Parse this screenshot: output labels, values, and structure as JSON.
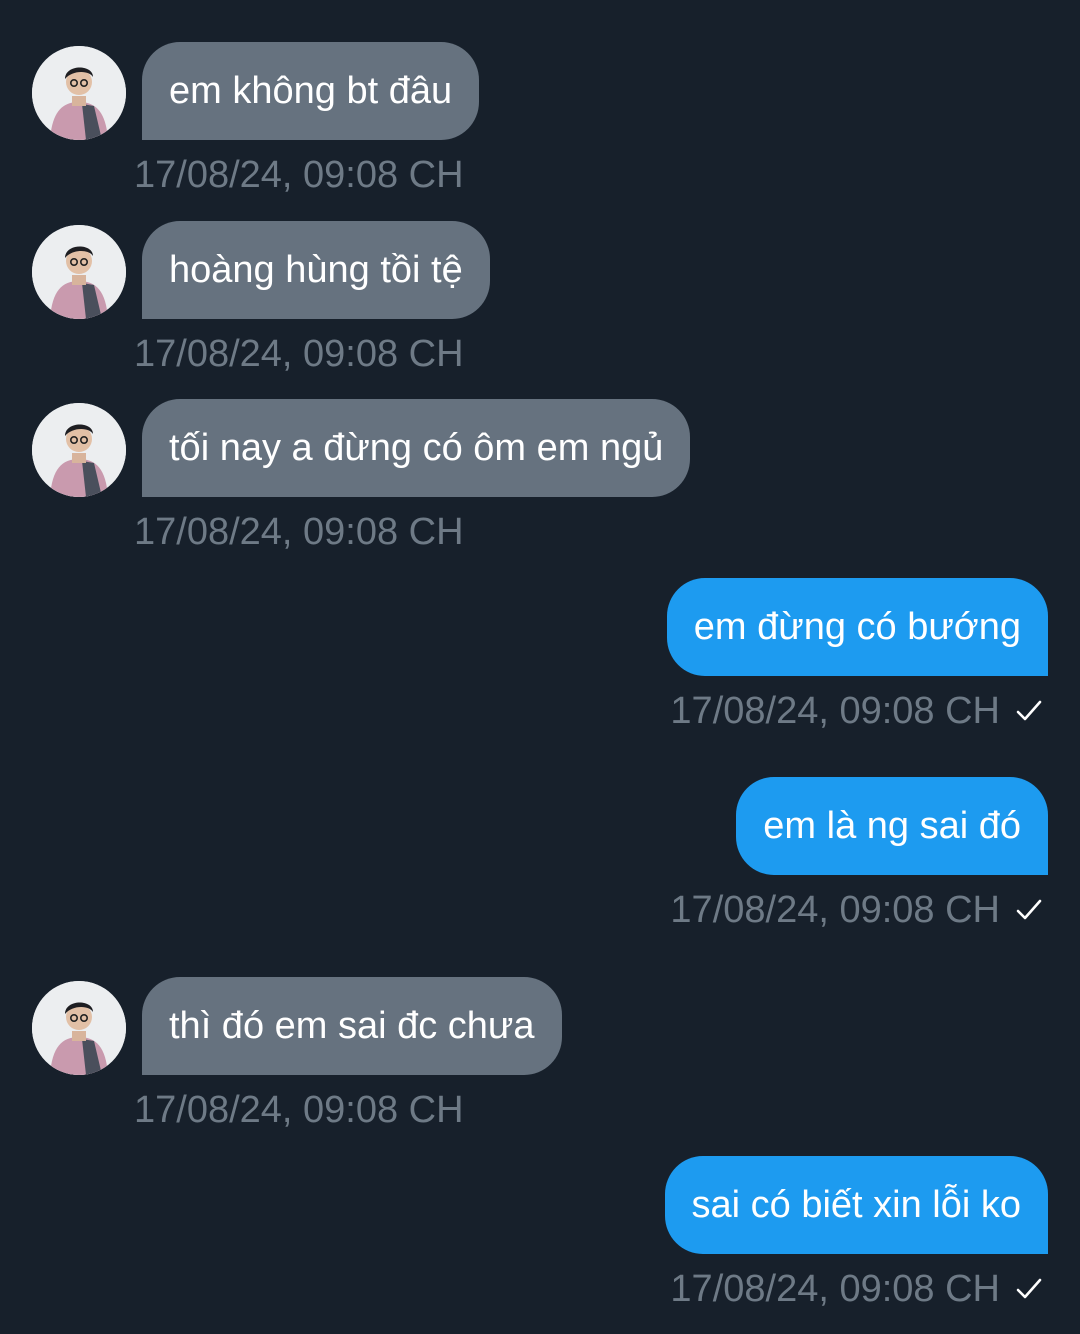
{
  "messages": [
    {
      "direction": "incoming",
      "text": "em không bt đâu",
      "timestamp": "17/08/24, 09:08 CH"
    },
    {
      "direction": "incoming",
      "text": "hoàng hùng tồi tệ",
      "timestamp": "17/08/24, 09:08 CH"
    },
    {
      "direction": "incoming",
      "text": "tối nay a đừng có ôm em ngủ",
      "timestamp": "17/08/24, 09:08 CH"
    },
    {
      "direction": "outgoing",
      "text": "em đừng có bướng",
      "timestamp": "17/08/24, 09:08 CH",
      "status": "sent"
    },
    {
      "direction": "outgoing",
      "text": "em là ng sai đó",
      "timestamp": "17/08/24, 09:08 CH",
      "status": "sent"
    },
    {
      "direction": "incoming",
      "text": "thì đó em sai đc chưa",
      "timestamp": "17/08/24, 09:08 CH"
    },
    {
      "direction": "outgoing",
      "text": "sai có biết xin lỗi ko",
      "timestamp": "17/08/24, 09:08 CH",
      "status": "sent"
    }
  ],
  "icons": {
    "sent_status": "checkmark-icon",
    "contact_avatar": "contact-avatar"
  },
  "colors": {
    "background": "#17202b",
    "incoming_bubble": "#66727f",
    "outgoing_bubble": "#1d9bf0",
    "message_text": "#ffffff",
    "timestamp": "#6e7a86",
    "checkmark": "#ffffff"
  }
}
